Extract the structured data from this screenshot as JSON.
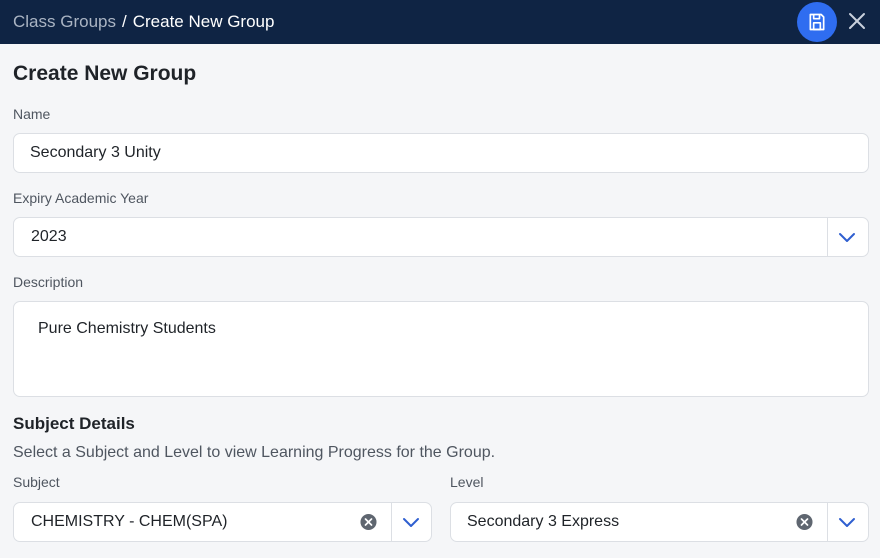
{
  "header": {
    "breadcrumb_parent": "Class Groups",
    "breadcrumb_separator": "/",
    "breadcrumb_current": "Create New Group",
    "save_icon": "save-icon",
    "close_icon": "close-icon"
  },
  "form": {
    "title": "Create New Group",
    "name": {
      "label": "Name",
      "value": "Secondary 3 Unity"
    },
    "expiry": {
      "label": "Expiry Academic Year",
      "value": "2023"
    },
    "description": {
      "label": "Description",
      "value": "Pure Chemistry Students"
    },
    "subject_details": {
      "title": "Subject Details",
      "description": "Select a Subject and Level to view Learning Progress for the Group.",
      "subject": {
        "label": "Subject",
        "value": "CHEMISTRY - CHEM(SPA)"
      },
      "level": {
        "label": "Level",
        "value": "Secondary 3 Express"
      }
    }
  },
  "colors": {
    "header_bg": "#0f2444",
    "accent": "#2f6df0",
    "chevron": "#2f5fd0"
  }
}
